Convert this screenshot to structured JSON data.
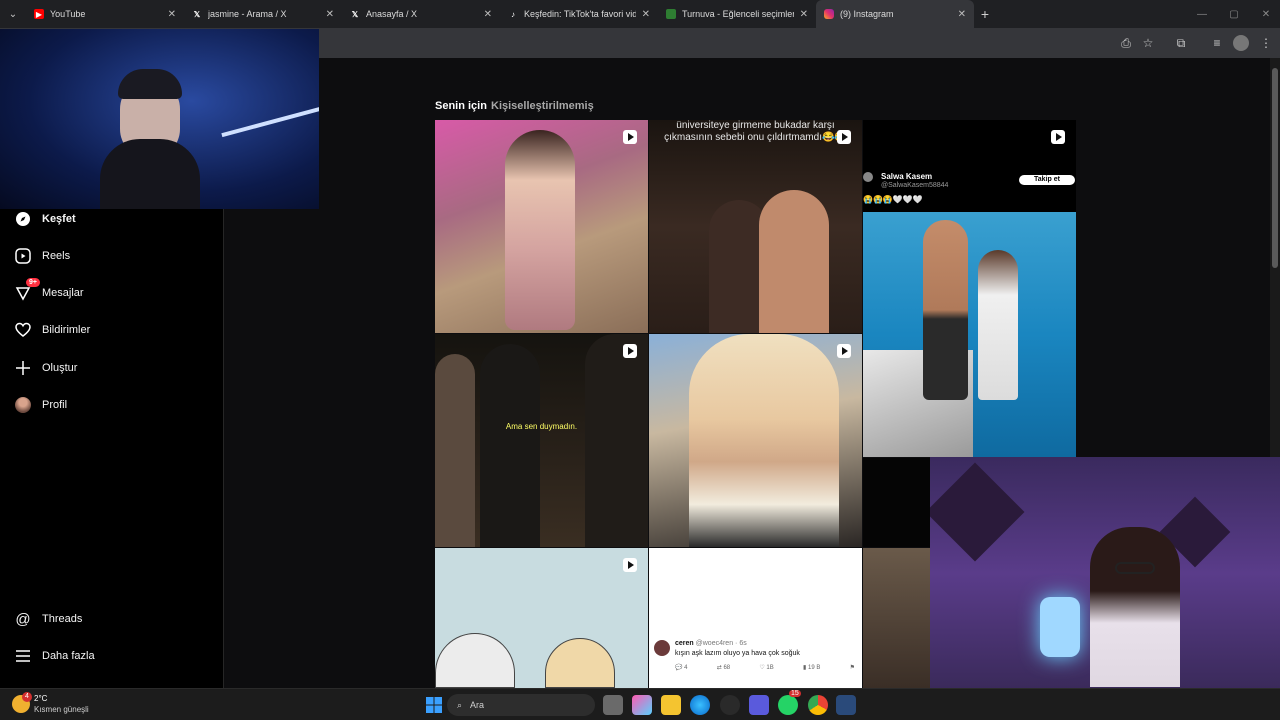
{
  "browser": {
    "tabs": [
      {
        "title": "YouTube",
        "favicon": "youtube-icon",
        "color": "#ff0000"
      },
      {
        "title": "jasmine - Arama / X",
        "favicon": "x-icon",
        "color": "#000000"
      },
      {
        "title": "Anasayfa / X",
        "favicon": "x-icon",
        "color": "#000000"
      },
      {
        "title": "Keşfedin: TikTok'ta favori videol",
        "favicon": "tiktok-icon",
        "color": "#000000"
      },
      {
        "title": "Turnuva - Eğlenceli seçimler yaş",
        "favicon": "turnuva-icon",
        "color": "#2e7d32"
      },
      {
        "title": "(9) Instagram",
        "favicon": "instagram-icon",
        "color": "#e1306c"
      }
    ],
    "close_glyph": "✕",
    "new_tab_glyph": "+"
  },
  "sidebar": {
    "items": [
      {
        "label": "Keşfet",
        "icon": "compass-icon",
        "bold": true
      },
      {
        "label": "Reels",
        "icon": "reels-icon"
      },
      {
        "label": "Mesajlar",
        "icon": "messenger-icon",
        "badge": "9+"
      },
      {
        "label": "Bildirimler",
        "icon": "heart-icon"
      },
      {
        "label": "Oluştur",
        "icon": "plus-icon"
      },
      {
        "label": "Profil",
        "icon": "avatar"
      }
    ],
    "bottom_items": [
      {
        "label": "Threads",
        "icon": "threads-icon"
      },
      {
        "label": "Daha fazla",
        "icon": "menu-icon"
      }
    ]
  },
  "feed": {
    "tabs": [
      "Senin için",
      "Kişiselleştirilmemiş"
    ],
    "tiles": [
      {
        "caption": ""
      },
      {
        "caption": "üniversiteye girmeme bukadar karşı çıkmasının sebebi onu çıldırtmamdı😂😂"
      },
      {
        "author": "Salwa Kasem",
        "handle": "@SalwaKasem58844",
        "follow": "Takip et",
        "emojis": "😭😭😭🤍🤍🤍"
      },
      {
        "caption": "Ama sen duymadın."
      },
      {
        "caption": ""
      },
      {
        "caption": ""
      },
      {
        "caption": ""
      },
      {
        "tweet_author": "ceren",
        "tweet_handle": "@woec4ren · 6s",
        "tweet_text": "kışın aşk lazım oluyo ya hava çok soğuk",
        "replies": "4",
        "retweets": "68",
        "likes": "1B",
        "views": "19 B"
      }
    ]
  },
  "taskbar": {
    "weather_temp": "2°C",
    "weather_desc": "Kısmen güneşli",
    "weather_badge": "4",
    "search_placeholder": "Ara",
    "whatsapp_badge": "15"
  }
}
